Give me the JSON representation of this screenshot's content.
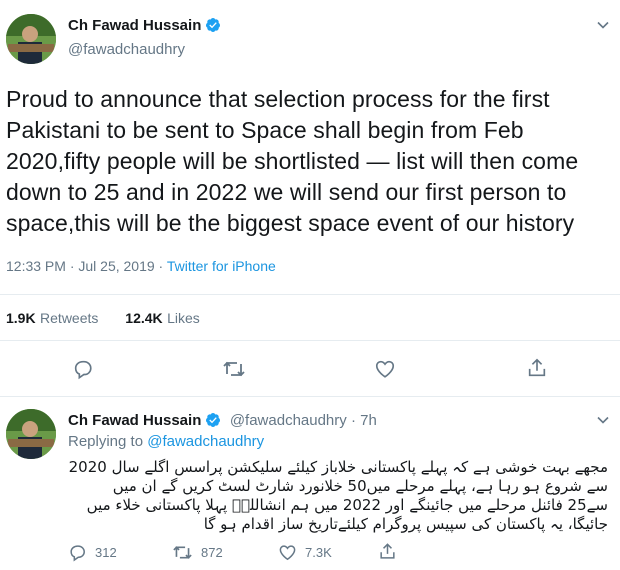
{
  "main_tweet": {
    "author_name": "Ch Fawad Hussain",
    "handle": "@fawadchaudhry",
    "text": "Proud to announce that selection process for the first Pakistani to be sent to Space shall begin from Feb 2020,fifty people will be shortlisted — list will then come down to 25 and in 2022 we will send our first person to space,this will be the biggest space event of our history",
    "time_date": "12:33 PM · Jul 25, 2019 · ",
    "source": "Twitter for iPhone",
    "retweets_count": "1.9K",
    "retweets_label": "Retweets",
    "likes_count": "12.4K",
    "likes_label": "Likes"
  },
  "reply_tweet": {
    "author_name": "Ch Fawad Hussain",
    "handle_time": "@fawadchaudhry · 7h",
    "replying_label": "Replying to ",
    "replying_handle": "@fawadchaudhry",
    "text": "مجھے بہت خوشی ہے کہ پہلے پاکستانی خلاباز کیلئے سلیکشن پراسس اگلے سال 2020 سے شروع ہو رہا ہے، پہلے مرحلے میں50 خلانورد شارٹ لسٹ کریں گے ان میں سے25 فائنل مرحلے میں جائینگے اور 2022 میں ہم انشاللہؐ پہلا پاکستانی خلاء میں جائیگا، یہ پاکستان کی سپیس پروگرام کیلئےتاریخ ساز اقدام ہو گا",
    "reply_count": "312",
    "retweet_count": "872",
    "like_count": "7.3K"
  },
  "icons": {
    "verified": "verified-badge-icon",
    "caret": "chevron-down-icon",
    "reply": "reply-icon",
    "retweet": "retweet-icon",
    "like": "heart-icon",
    "share": "share-icon"
  },
  "colors": {
    "link": "#1b95e0",
    "secondary_text": "#657786",
    "primary_text": "#14171a",
    "verified": "#1da1f2",
    "divider": "#e6ecf0"
  }
}
